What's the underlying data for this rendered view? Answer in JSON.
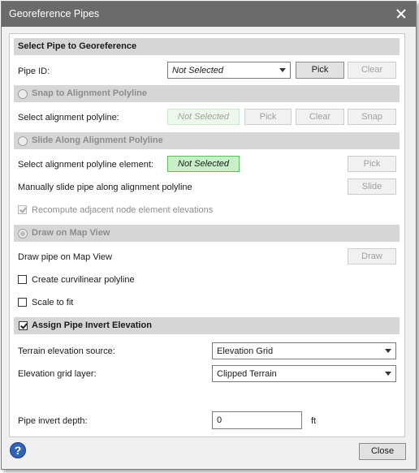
{
  "window": {
    "title": "Georeference Pipes"
  },
  "select_pipe": {
    "header": "Select Pipe to Georeference",
    "pipe_id_label": "Pipe ID:",
    "pipe_id_value": "Not Selected",
    "pick_label": "Pick",
    "clear_label": "Clear"
  },
  "snap": {
    "header": "Snap to Alignment Polyline",
    "select_label": "Select alignment polyline:",
    "status": "Not Selected",
    "pick_label": "Pick",
    "clear_label": "Clear",
    "snap_label": "Snap"
  },
  "slide": {
    "header": "Slide Along Alignment Polyline",
    "select_label": "Select alignment polyline element:",
    "status": "Not Selected",
    "pick_label": "Pick",
    "manual_label": "Manually slide pipe along alignment polyline",
    "slide_label": "Slide",
    "recompute_label": "Recompute adjacent node element elevations",
    "recompute_checked": true
  },
  "draw": {
    "header": "Draw on Map View",
    "draw_pipe_label": "Draw pipe on Map View",
    "draw_label": "Draw",
    "curvilinear_label": "Create curvilinear polyline",
    "curvilinear_checked": false,
    "scale_label": "Scale to fit",
    "scale_checked": false
  },
  "invert": {
    "header": "Assign Pipe Invert Elevation",
    "checked": true,
    "terrain_label": "Terrain elevation source:",
    "terrain_value": "Elevation Grid",
    "grid_layer_label": "Elevation grid layer:",
    "grid_layer_value": "Clipped Terrain",
    "depth_label": "Pipe invert depth:",
    "depth_value": "0",
    "depth_unit": "ft"
  },
  "footer": {
    "help_glyph": "?",
    "close_label": "Close"
  },
  "colors": {
    "title_bar": "#6b6b6b",
    "section_header": "#d6d6d6",
    "status_green": "#c8f0c8",
    "help_blue": "#2f63b8"
  }
}
